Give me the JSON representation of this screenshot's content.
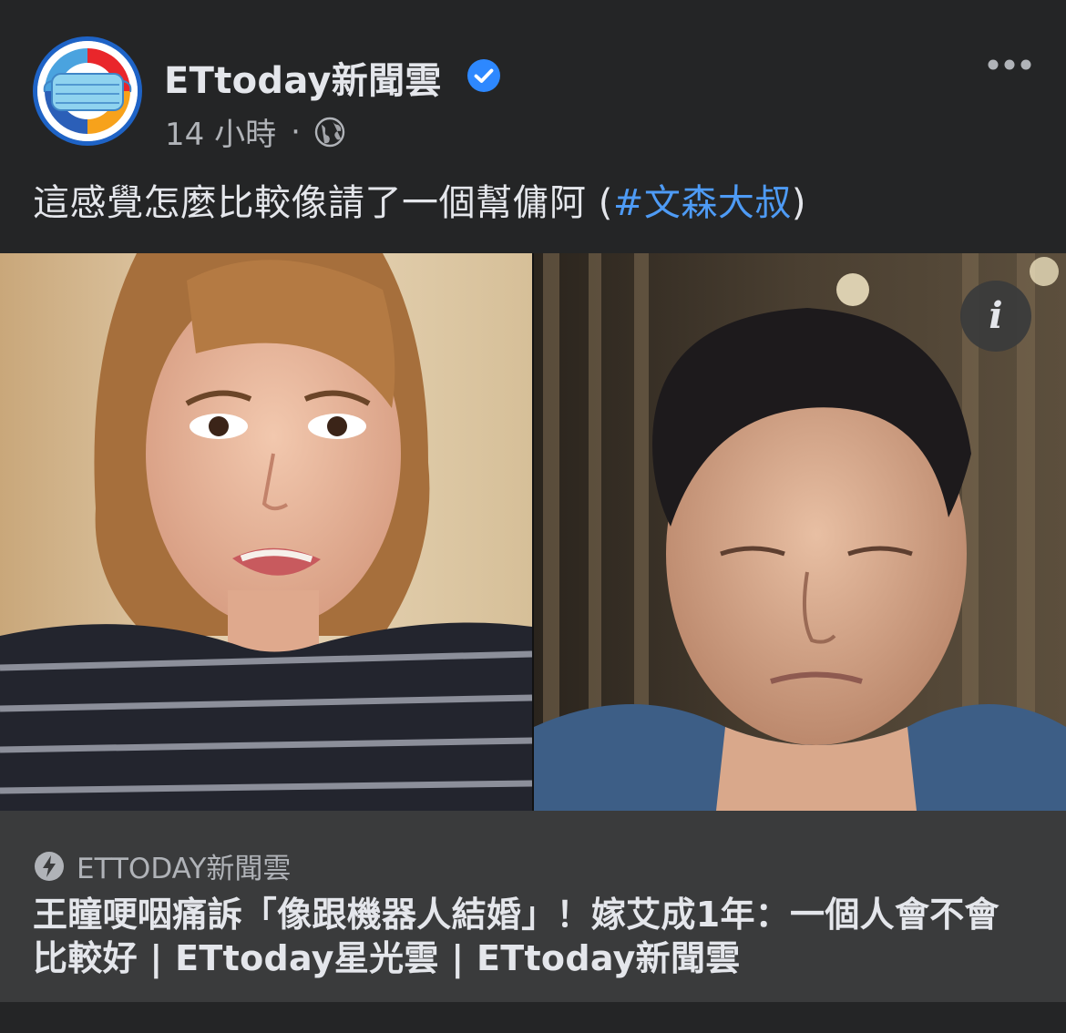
{
  "post": {
    "page_name": "ETtoday新聞雲",
    "verified_icon": "verified-badge-icon",
    "timestamp": "14 小時",
    "separator": "·",
    "audience_icon": "globe-icon",
    "more_icon": "more-options-icon",
    "text_before_hashtag": "這感覺怎麼比較像請了一個幫傭阿 (",
    "hashtag": "#文森大叔",
    "text_after_hashtag": ")"
  },
  "media": {
    "info_label": "i",
    "info_icon": "info-icon"
  },
  "link_preview": {
    "source_icon": "instant-article-bolt-icon",
    "source": "ETTODAY新聞雲",
    "title": "王瞳哽咽痛訴「像跟機器人結婚」！嫁艾成1年：一個人會不會比較好 | ETtoday星光雲 | ETtoday新聞雲"
  },
  "colors": {
    "background": "#242526",
    "preview_background": "#3a3b3c",
    "text_primary": "#e4e6eb",
    "text_secondary": "#b0b3b8",
    "hashtag": "#4e9bf5",
    "verified": "#2d88ff"
  }
}
